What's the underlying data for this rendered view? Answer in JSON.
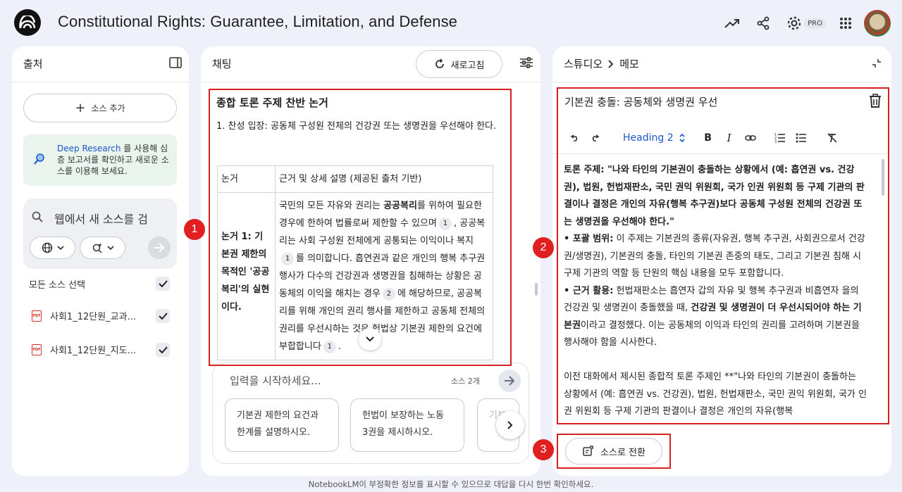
{
  "app": {
    "title": "Constitutional Rights: Guarantee, Limitation, and Defense",
    "pro_badge": "PRO",
    "footer": "NotebookLM이 부정확한 정보를 표시할 수 있으므로 대답을 다시 한번 확인하세요."
  },
  "sources": {
    "header": "출처",
    "add_label": "소스 추가",
    "deep_research_link": "Deep Research",
    "deep_research_text": " 를 사용해 심층 보고서를 확인하고 새로운 소스를 이용해 보세요.",
    "web_search_placeholder": "웹에서 새 소스를 검",
    "select_all": "모든 소스 선택",
    "items": [
      {
        "name": "사회1_12단원_교과..."
      },
      {
        "name": "사회1_12단원_지도..."
      }
    ]
  },
  "chat": {
    "header": "채팅",
    "refresh_label": "새로고침",
    "message_title": "종합 토론 주제 찬반 논거",
    "message_intro": "1. 찬성 입장: 공동체 구성원 전체의 건강권 또는 생명권을 우선해야 한다.",
    "table": {
      "headers": [
        "논거",
        "근거 및 상세 설명 (제공된 출처 기반)"
      ],
      "row1_label": "논거 1: 기본권 제한의 목적인 '공공복리'의 실현이다.",
      "row1_a": "국민의 모든 자유와 권리는 ",
      "row1_bold": "공공복리",
      "row1_b": "를 위하여 필요한 경우에 한하여 법률로써 제한할 수 있으며",
      "row1_c": ", 공공복리는 사회 구성원 전체에게 공통되는 이익이나 복지",
      "row1_d": "를 의미합니다. 흡연권과 같은 개인의 행복 추구권 행사가 다수의 건강권과 생명권을 침해하는 상황은 공동체의 이익을 해치는 경우",
      "row1_e": "에 해당하므로, 공공복리를 위해 개인의 권리 행사를 제한하고 공동체 전체의 권리를 우선시하는 것은 헌법상 기본권 제한의 요건에 부합합니다",
      "row1_f": ".",
      "cites": [
        "1",
        "1",
        "2",
        "1"
      ]
    },
    "input_placeholder": "입력을 시작하세요...",
    "source_count": "소스 2개",
    "suggestions": [
      "기본권 제한의 요건과 한계를 설명하시오.",
      "헌법이 보장하는 노동 3권을 제시하시오.",
      "기본"
    ]
  },
  "studio": {
    "crumb_root": "스튜디오",
    "crumb_leaf": "메모",
    "note_title": "기본권 충돌: 공동체와 생명권 우선",
    "heading_select": "Heading 2",
    "to_source_label": "소스로 전환",
    "body": {
      "topic_label": "토론 주제: ",
      "topic_text": "\"나와 타인의 기본권이 충돌하는 상황에서 (예: 흡연권 vs. 건강권), 법원, 헌법재판소, 국민 권익 위원회, 국가 인권 위원회 등 구제 기관의 판결이나 결정은 개인의 자유(행복 추구권)보다 공동체 구성원 전체의 건강권 또는 생명권을 우선해야 한다.\"",
      "scope_label": "• 포괄 범위:",
      "scope_text": " 이 주제는 기본권의 종류(자유권, 행복 추구권, 사회권으로서 건강권/생명권), 기본권의 충돌, 타인의 기본권 존중의 태도, 그리고 기본권 침해 시 구제 기관의 역할 등 단원의 핵심 내용을 모두 포함합니다.",
      "use_label": "• 근거 활용:",
      "use_text_a": " 헌법재판소는 흡연자 갑의 자유 및 행복 추구권과 비흡연자 을의 건강권 및 생명권이 충돌했을 때, ",
      "use_bold": "건강권 및 생명권이 더 우선시되어야 하는 기본권",
      "use_text_b": "이라고 결정했다. 이는 공동체의 이익과 타인의 권리를 고려하며 기본권을 행사해야 함을 시사한다.",
      "para2": "이전 대화에서 제시된 종합적 토론 주제인 **\"나와 타인의 기본권이 충돌하는 상황에서 (예: 흡연권 vs. 건강권), 법원, 헌법재판소, 국민 권익 위원회, 국가 인권 위원회 등 구제 기관의 판결이나 결정은 개인의 자유(행복"
    }
  },
  "annotations": [
    "1",
    "2",
    "3"
  ],
  "colors": {
    "accent": "#1a56c6",
    "annotation": "#e02020",
    "deep_bg": "#e9f4ec",
    "page_bg": "#eef1fa"
  }
}
